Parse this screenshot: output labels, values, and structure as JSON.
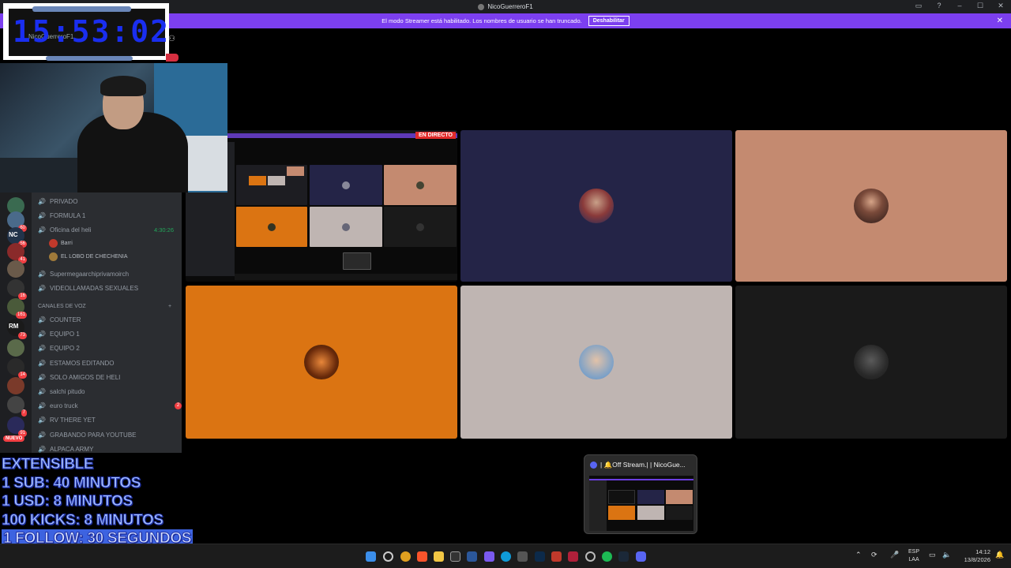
{
  "window": {
    "title": "NicoGuerreroF1",
    "controls": [
      "▭",
      "?",
      "–",
      "☐",
      "✕"
    ]
  },
  "banner": {
    "text": "El modo Streamer está habilitado. Los nombres de usuario se han truncado.",
    "button_label": "Deshabilitar",
    "close_glyph": "✕"
  },
  "overlay_clock": {
    "time": "15:53:02",
    "subtitle": "NicoGuerreroF1"
  },
  "servers": [
    {
      "label": "",
      "badge": "",
      "color": "#3a6a50"
    },
    {
      "label": "",
      "badge": "60",
      "color": "#4a6a8a"
    },
    {
      "label": "NC",
      "badge": "56",
      "color": "#22334a"
    },
    {
      "label": "",
      "badge": "41",
      "color": "#8a2a2a"
    },
    {
      "label": "",
      "badge": "",
      "color": "#6a5a4a"
    },
    {
      "label": "",
      "badge": "16",
      "color": "#333"
    },
    {
      "label": "",
      "badge": "161",
      "color": "#4a5a3a"
    },
    {
      "label": "RM",
      "badge": "73",
      "color": "#1a1a1a"
    },
    {
      "label": "",
      "badge": "",
      "color": "#5a6a4a"
    },
    {
      "label": "",
      "badge": "14",
      "color": "#2a2a2a"
    },
    {
      "label": "",
      "badge": "",
      "color": "#7a3a2a"
    },
    {
      "label": "",
      "badge": "7",
      "color": "#444"
    },
    {
      "label": "",
      "badge": "91",
      "color": "#2a2a5a"
    }
  ],
  "nuevo_label": "NUEVO",
  "channels": {
    "top": [
      {
        "name": "PRIVADO"
      },
      {
        "name": "FORMULA 1"
      },
      {
        "name": "Oficina del heli",
        "time": "4:30:26",
        "active": true
      },
      {
        "name": "Supermegaarchiprivamoirch"
      },
      {
        "name": "VIDEOLLAMADAS SEXUALES"
      }
    ],
    "users": [
      {
        "name": "Barri",
        "color": "#c0392b"
      },
      {
        "name": "EL LOBO DE CHECHENIA",
        "color": "#a07a3a"
      }
    ],
    "category": "CANALES DE VOZ",
    "category_plus": "+",
    "voice": [
      {
        "name": "COUNTER"
      },
      {
        "name": "EQUIPO 1"
      },
      {
        "name": "EQUIPO 2"
      },
      {
        "name": "ESTAMOS EDITANDO"
      },
      {
        "name": "SOLO AMIGOS DE HELI"
      },
      {
        "name": "salchi pitudo"
      },
      {
        "name": "euro truck",
        "mention": "2"
      },
      {
        "name": "RV THERE YET"
      },
      {
        "name": "GRABANDO PARA YOUTUBE"
      },
      {
        "name": "ALPACA ARMY"
      }
    ]
  },
  "share": {
    "live_label": "EN DIRECTO"
  },
  "rules": [
    "EXTENSIBLE",
    "1 SUB: 40 MINUTOS",
    "1 USD: 8 MINUTOS",
    "100 KICKS: 8 MINUTOS",
    "1 FOLLOW: 30 SEGUNDOS"
  ],
  "preview": {
    "title": "| 🔔Off Stream.| | NicoGue..."
  },
  "taskbar": {
    "lang_top": "ESP",
    "lang_bottom": "LAA",
    "time": "14:12",
    "date": "13/8/2026"
  }
}
